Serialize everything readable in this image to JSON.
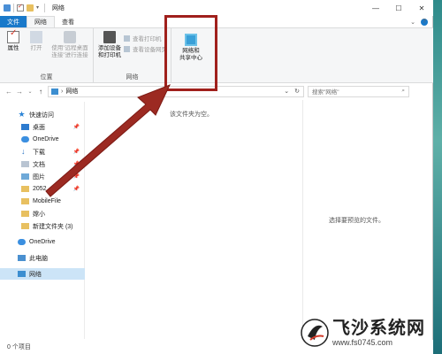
{
  "window": {
    "title": "网络",
    "controls": {
      "minimize": "—",
      "maximize": "☐",
      "close": "✕"
    }
  },
  "tabs": [
    {
      "label": "文件"
    },
    {
      "label": "网络"
    },
    {
      "label": "查看"
    }
  ],
  "ribbon": {
    "location_group": {
      "label": "位置",
      "properties": "属性",
      "open": "打开",
      "remote_line1": "使用\"远程桌面",
      "remote_line2": "连接\"进行连接"
    },
    "network_group": {
      "label": "网络",
      "add_device_line1": "添加设备",
      "add_device_line2": "和打印机",
      "view_printers": "查看打印机",
      "view_device_web": "查看设备网页"
    },
    "net_center_line1": "网络和",
    "net_center_line2": "共享中心"
  },
  "address": {
    "path": "网络",
    "search_placeholder": "搜索\"网络\""
  },
  "nav": {
    "quick_access": "快速访问",
    "desktop": "桌面",
    "onedrive_quick": "OneDrive",
    "downloads": "下载",
    "documents": "文档",
    "pictures": "图片",
    "folder_2052": "2052",
    "mobilefile": "MobileFile",
    "folder_user": "嫦小",
    "new_folder": "新建文件夹 (3)",
    "onedrive": "OneDrive",
    "this_pc": "此电脑",
    "network": "网络"
  },
  "content": {
    "empty_message": "该文件夹为空。",
    "preview_message": "选择要预览的文件。"
  },
  "status": {
    "item_count": "0 个项目"
  },
  "watermark": {
    "site_name": "飞沙系统网",
    "url": "www.fs0745.com"
  },
  "colors": {
    "file_tab": "#1979ca",
    "selection": "#cce4f7",
    "annotation": "#a0201c"
  }
}
